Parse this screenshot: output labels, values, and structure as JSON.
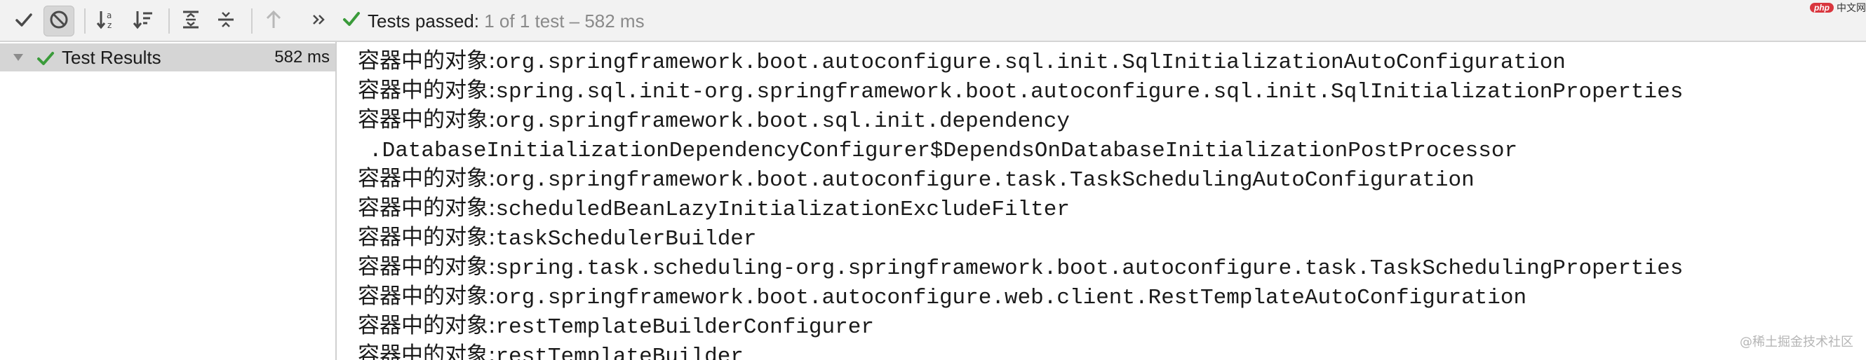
{
  "toolbar": {
    "buttons": [
      {
        "name": "show-passed-button",
        "icon": "checkmark-icon"
      },
      {
        "name": "show-ignored-button",
        "icon": "no-entry-icon"
      },
      {
        "name": "sort-alphabetically-button",
        "icon": "sort-alpha-icon"
      },
      {
        "name": "sort-by-duration-button",
        "icon": "sort-duration-icon"
      },
      {
        "name": "expand-all-button",
        "icon": "expand-all-icon"
      },
      {
        "name": "collapse-all-button",
        "icon": "collapse-all-icon"
      },
      {
        "name": "previous-failed-button",
        "icon": "arrow-up-icon"
      },
      {
        "name": "more-button",
        "icon": "double-chevron-right-icon"
      }
    ],
    "status_prefix": "Tests passed:",
    "status_count": "1",
    "status_rest": "of 1 test – 582 ms",
    "success_color": "#3a9b3a"
  },
  "corner_logo": {
    "badge": "php",
    "text": "中文网"
  },
  "tree": {
    "root_label": "Test Results",
    "root_time": "582 ms"
  },
  "console": {
    "lines": [
      {
        "prefix": "容器中的对象:",
        "text": "org.springframework.boot.autoconfigure.sql.init.SqlInitializationAutoConfiguration"
      },
      {
        "prefix": "容器中的对象:",
        "text": "spring.sql.init-org.springframework.boot.autoconfigure.sql.init.SqlInitializationProperties"
      },
      {
        "prefix": "容器中的对象:",
        "text": "org.springframework.boot.sql.init.dependency"
      },
      {
        "prefix": "",
        "text": ".DatabaseInitializationDependencyConfigurer$DependsOnDatabaseInitializationPostProcessor"
      },
      {
        "prefix": "容器中的对象:",
        "text": "org.springframework.boot.autoconfigure.task.TaskSchedulingAutoConfiguration"
      },
      {
        "prefix": "容器中的对象:",
        "text": "scheduledBeanLazyInitializationExcludeFilter"
      },
      {
        "prefix": "容器中的对象:",
        "text": "taskSchedulerBuilder"
      },
      {
        "prefix": "容器中的对象:",
        "text": "spring.task.scheduling-org.springframework.boot.autoconfigure.task.TaskSchedulingProperties"
      },
      {
        "prefix": "容器中的对象:",
        "text": "org.springframework.boot.autoconfigure.web.client.RestTemplateAutoConfiguration"
      },
      {
        "prefix": "容器中的对象:",
        "text": "restTemplateBuilderConfigurer"
      },
      {
        "prefix": "容器中的对象:",
        "text": "restTemplateBuilder"
      }
    ]
  },
  "watermark": "@稀土掘金技术社区"
}
